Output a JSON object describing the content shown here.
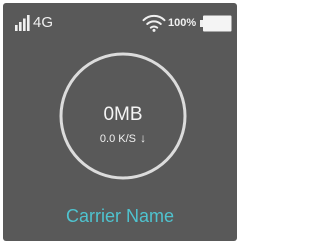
{
  "status_bar": {
    "signal_icon": "signal-bars-icon",
    "network_type": "4G",
    "wifi_icon": "wifi-icon",
    "battery_percent": "100%",
    "battery_icon": "battery-full-icon"
  },
  "usage": {
    "data_used": "0MB",
    "speed": "0.0 K/S",
    "speed_direction_icon": "down-arrow-icon",
    "speed_arrow": "↓"
  },
  "carrier": {
    "name": "Carrier Name"
  },
  "colors": {
    "background": "#595959",
    "text": "#f0f0f0",
    "accent": "#4fc3cf",
    "ring": "#dcdcdc"
  }
}
